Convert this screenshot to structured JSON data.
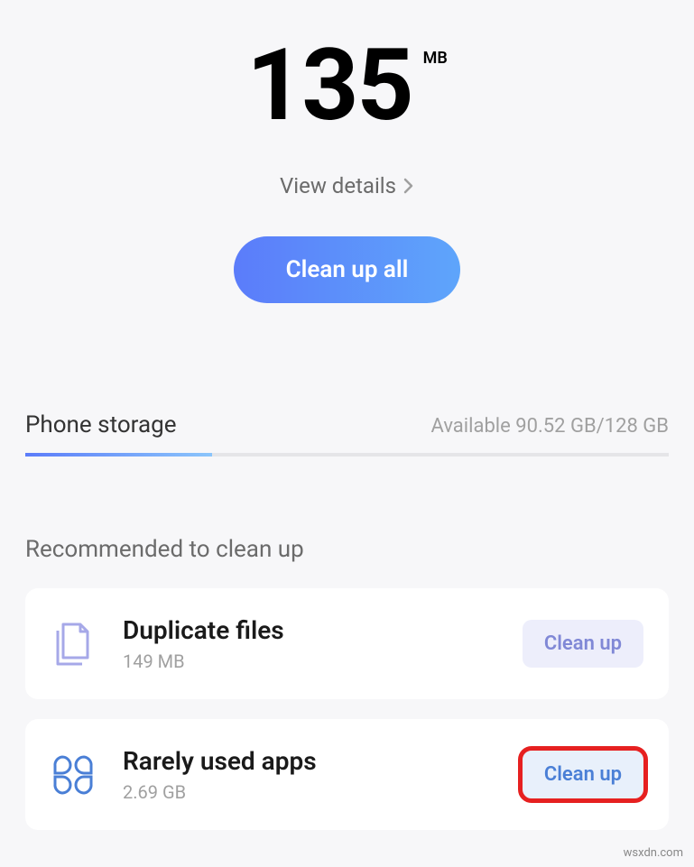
{
  "header": {
    "size_value": "135",
    "size_unit": "MB",
    "view_details_label": "View details",
    "clean_all_label": "Clean up all"
  },
  "storage": {
    "title": "Phone storage",
    "available_text": "Available 90.52 GB/128 GB",
    "fill_percent": 29
  },
  "recommended": {
    "title": "Recommended to clean up",
    "items": [
      {
        "icon": "duplicate-files-icon",
        "title": "Duplicate files",
        "subtitle": "149 MB",
        "button_label": "Clean up",
        "highlighted": false
      },
      {
        "icon": "rarely-used-apps-icon",
        "title": "Rarely used apps",
        "subtitle": "2.69 GB",
        "button_label": "Clean up",
        "highlighted": true
      }
    ]
  },
  "watermark": "wsxdn.com"
}
